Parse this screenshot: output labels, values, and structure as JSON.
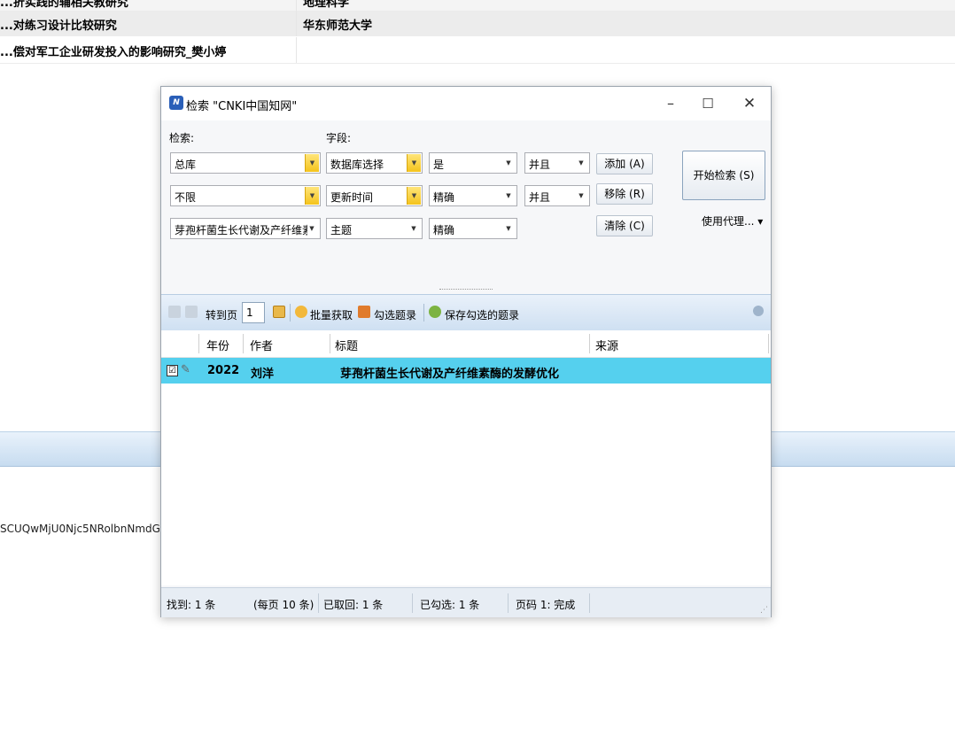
{
  "background": {
    "rows": [
      {
        "col1": "...折实践的辅相关教研究",
        "col2": "地理科学"
      },
      {
        "col1": "...对练习设计比较研究",
        "col2": "华东师范大学"
      },
      {
        "col1": "...偿对军工企业研发投入的影响研究_樊小婷",
        "col2": ""
      }
    ],
    "code_text": "SCUQwMjU0Njc5NRolbnNmdG:"
  },
  "dialog": {
    "title": "检索 \"CNKI中国知网\"",
    "icon": "cnki-app-icon",
    "window_controls": {
      "minimize": "–",
      "maximize": "☐",
      "close": "✕"
    },
    "search_label": "检索:",
    "field_label": "字段:",
    "rows": [
      {
        "term": "总库",
        "field": "数据库选择",
        "match": "是",
        "logic": "并且"
      },
      {
        "term": "不限",
        "field": "更新时间",
        "match": "精确",
        "logic": "并且"
      },
      {
        "term": "芽孢杆菌生长代谢及产纤维素",
        "field": "主题",
        "match": "精确"
      }
    ],
    "buttons": {
      "add": "添加 (A)",
      "remove": "移除 (R)",
      "clear": "清除 (C)",
      "start": "开始检索 (S)"
    },
    "proxy": "使用代理... ▾",
    "toolbar": {
      "goto": "转到页",
      "page": "1",
      "batch": "批量获取",
      "check": "勾选题录",
      "save": "保存勾选的题录"
    },
    "grid": {
      "columns": [
        "年份",
        "作者",
        "标题",
        "来源"
      ],
      "rows": [
        {
          "checked": "☑",
          "year": "2022",
          "author": "刘洋",
          "title": "芽孢杆菌生长代谢及产纤维素酶的发酵优化",
          "source": ""
        }
      ]
    },
    "status": {
      "found": "找到: 1 条",
      "per_page": "(每页 10 条)",
      "fetched": "已取回: 1 条",
      "checked": "已勾选: 1 条",
      "page": "页码 1: 完成"
    }
  }
}
